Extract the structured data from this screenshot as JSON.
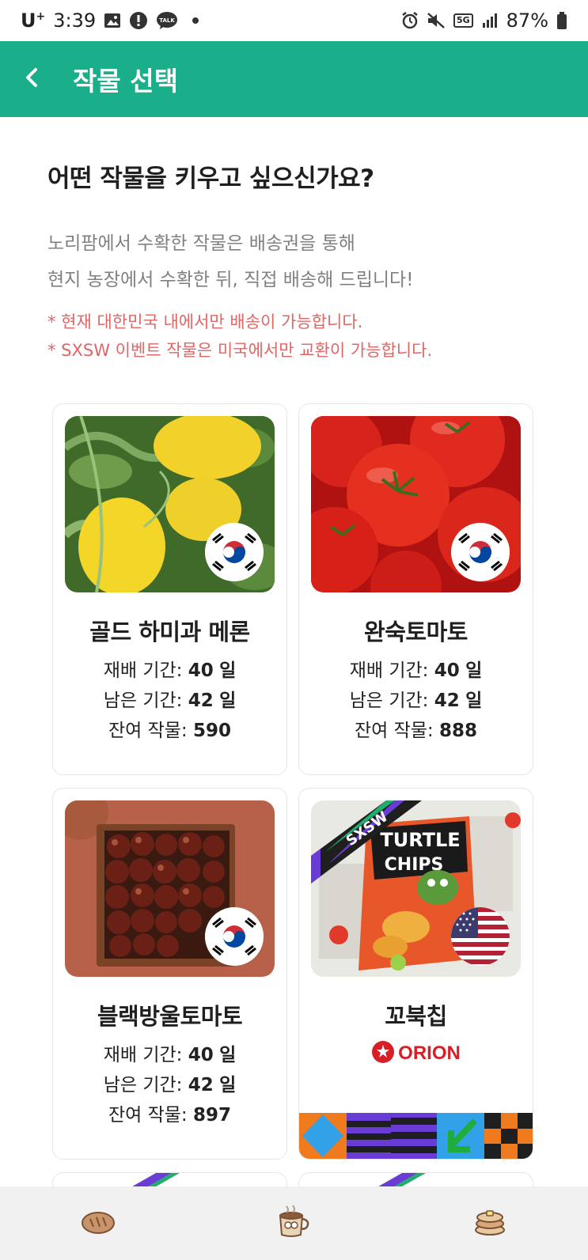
{
  "status_bar": {
    "carrier": "U",
    "carrier_sup": "+",
    "time": "3:39",
    "network_badge": "5G",
    "battery": "87%",
    "icons": [
      "image-icon",
      "alert-icon",
      "talk-icon",
      "alarm-icon",
      "mute-icon",
      "signal-icon",
      "battery-icon"
    ],
    "talk_label": "TALK"
  },
  "header": {
    "title": "작물 선택",
    "back_icon": "chevron-left-icon",
    "bg_color": "#1aae8a"
  },
  "intro": {
    "question": "어떤 작물을 키우고 싶으신가요?",
    "desc_line1": "노리팜에서 수확한 작물은 배송권을 통해",
    "desc_line2": "현지 농장에서 수확한 뒤, 직접 배송해 드립니다!",
    "note1": "* 현재 대한민국 내에서만 배송이 가능합니다.",
    "note2": "* SXSW 이벤트 작물은 미국에서만 교환이 가능합니다."
  },
  "labels": {
    "period": "재배 기간:",
    "remaining": "남은 기간:",
    "stock": "잔여 작물:",
    "day_unit": "일"
  },
  "crops": [
    {
      "name": "골드 하미과 메론",
      "period": "40",
      "remaining": "42",
      "stock": "590",
      "flag": "korea-flag-icon"
    },
    {
      "name": "완숙토마토",
      "period": "40",
      "remaining": "42",
      "stock": "888",
      "flag": "korea-flag-icon"
    },
    {
      "name": "블랙방울토마토",
      "period": "40",
      "remaining": "42",
      "stock": "897",
      "flag": "korea-flag-icon"
    },
    {
      "name": "꼬북칩",
      "brand": "ORION",
      "ribbon": "SXSW",
      "pack_title1": "TURTLE",
      "pack_title2": "CHIPS",
      "flag": "usa-flag-icon"
    }
  ],
  "bottom_nav": {
    "items": [
      "bread-icon",
      "coffee-icon",
      "pancake-icon"
    ]
  }
}
